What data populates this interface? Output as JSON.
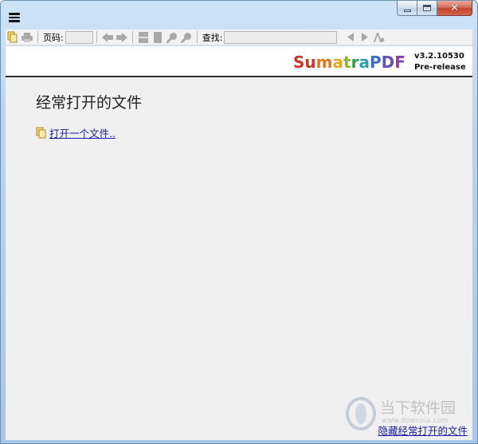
{
  "toolbar": {
    "page_label": "页码:",
    "page_value": "",
    "find_label": "查找:",
    "find_value": ""
  },
  "header": {
    "brand_parts": [
      {
        "text": "S",
        "color": "#c9362b"
      },
      {
        "text": "u",
        "color": "#c9362b"
      },
      {
        "text": "m",
        "color": "#e07a1f"
      },
      {
        "text": "a",
        "color": "#e8a91c"
      },
      {
        "text": "t",
        "color": "#8fb52a"
      },
      {
        "text": "r",
        "color": "#2f9f45"
      },
      {
        "text": "a",
        "color": "#2b9db4"
      },
      {
        "text": "P",
        "color": "#3d6fc4"
      },
      {
        "text": "D",
        "color": "#6a4fb6"
      },
      {
        "text": "F",
        "color": "#8a3fa8"
      }
    ],
    "version_line1": "v3.2.10530",
    "version_line2": "Pre-release"
  },
  "main": {
    "title": "经常打开的文件",
    "open_file_link": "打开一个文件..",
    "hide_link": "隐藏经常打开的文件"
  },
  "watermark": {
    "text": "当下软件园",
    "sub": "www.downxia.com"
  }
}
